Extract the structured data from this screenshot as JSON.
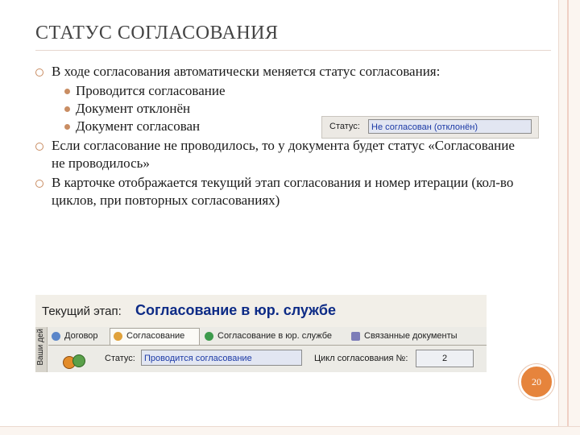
{
  "slide": {
    "title": "СТАТУС СОГЛАСОВАНИЯ",
    "page_number": "20"
  },
  "bullets": [
    {
      "text": "В ходе согласования автоматически меняется статус согласования:"
    },
    {
      "text": "Если согласование не проводилось, то у документа будет статус «Согласование не проводилось»"
    },
    {
      "text": "В карточке отображается текущий этап согласования и номер итерации (кол-во циклов, при повторных согласованиях)"
    }
  ],
  "sub_bullets": [
    {
      "text": "Проводится согласование"
    },
    {
      "text": "Документ отклонён"
    },
    {
      "text": "Документ согласован"
    }
  ],
  "status_field": {
    "label": "Статус:",
    "value": "Не согласован (отклонён)"
  },
  "card": {
    "stage_label": "Текущий этап:",
    "stage_value": "Согласование в юр. службе",
    "side_tab": "Ваши дей",
    "tabs": [
      {
        "label": "Договор",
        "icon": "document-icon"
      },
      {
        "label": "Согласование",
        "icon": "users-icon"
      },
      {
        "label": "Согласование в юр. службе",
        "icon": "check-icon"
      },
      {
        "label": "Связанные документы",
        "icon": "links-icon"
      }
    ],
    "status_label": "Статус:",
    "status_value": "Проводится согласование",
    "cycle_label": "Цикл согласования №:",
    "cycle_value": "2"
  },
  "colors": {
    "accent": "#c98d63",
    "page_badge": "#e6843c",
    "field_text": "#1c3aa6",
    "stage_text": "#0d2b86"
  }
}
